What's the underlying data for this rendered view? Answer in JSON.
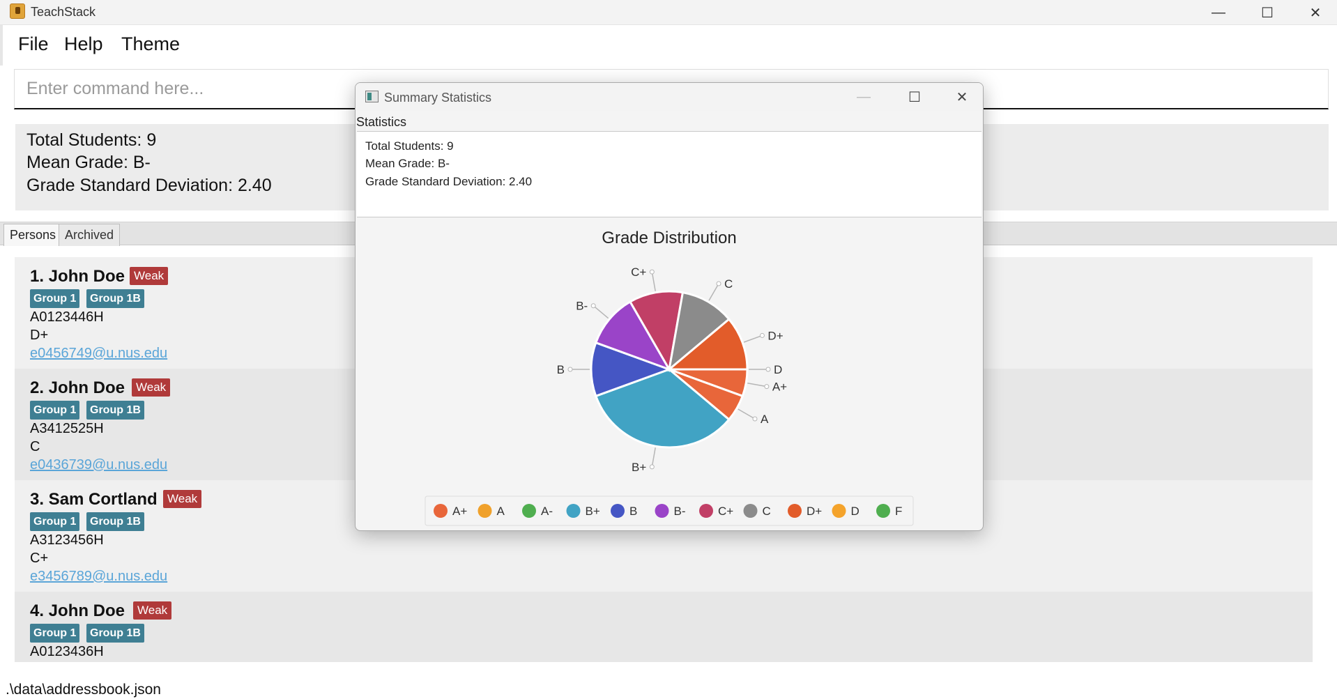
{
  "app": {
    "title": "TeachStack"
  },
  "window_controls": {
    "minimize": "—",
    "maximize": "☐",
    "close": "✕"
  },
  "menu": {
    "file": "File",
    "help": "Help",
    "theme": "Theme"
  },
  "command": {
    "placeholder": "Enter command here..."
  },
  "summary": {
    "total": "Total Students: 9",
    "mean": "Mean Grade: B-",
    "std": "Grade Standard Deviation: 2.40"
  },
  "tabs": {
    "persons": "Persons",
    "archived": "Archived"
  },
  "persons": [
    {
      "index_name": "1.  John Doe",
      "tag": "Weak",
      "groups": [
        "Group 1",
        "Group 1B"
      ],
      "id": "A0123446H",
      "grade": "D+",
      "email": "e0456749@u.nus.edu"
    },
    {
      "index_name": "2.  John Doe",
      "tag": "Weak",
      "groups": [
        "Group 1",
        "Group 1B"
      ],
      "id": "A3412525H",
      "grade": "C",
      "email": "e0436739@u.nus.edu"
    },
    {
      "index_name": "3.  Sam Cortland",
      "tag": "Weak",
      "groups": [
        "Group 1",
        "Group 1B"
      ],
      "id": "A3123456H",
      "grade": "C+",
      "email": "e3456789@u.nus.edu"
    },
    {
      "index_name": "4.  John Doe",
      "tag": "Weak",
      "groups": [
        "Group 1",
        "Group 1B"
      ],
      "id": "A0123436H",
      "grade": "",
      "email": ""
    }
  ],
  "status": {
    "path": ".\\data\\addressbook.json"
  },
  "popup": {
    "title": "Summary Statistics",
    "controls": {
      "minimize": "—",
      "maximize": "☐",
      "close": "✕"
    },
    "section_label": "Statistics",
    "stats": {
      "total": "Total Students: 9",
      "mean": "Mean Grade: B-",
      "std": "Grade Standard Deviation: 2.40"
    }
  },
  "chart_data": {
    "type": "pie",
    "title": "Grade Distribution",
    "slices": [
      {
        "label": "A+",
        "value": 0.5,
        "color": "#e8663a"
      },
      {
        "label": "A",
        "value": 0.5,
        "color": "#e8663a"
      },
      {
        "label": "B+",
        "value": 3,
        "color": "#41a3c4"
      },
      {
        "label": "B",
        "value": 1,
        "color": "#4556c4"
      },
      {
        "label": "B-",
        "value": 1,
        "color": "#9a44c8"
      },
      {
        "label": "C+",
        "value": 1,
        "color": "#c13f66"
      },
      {
        "label": "C",
        "value": 1,
        "color": "#8b8b8b"
      },
      {
        "label": "D+",
        "value": 1,
        "color": "#e25c2a"
      },
      {
        "label": "D",
        "value": 0,
        "color": "#f4a32b"
      }
    ],
    "legend": [
      {
        "label": "A+",
        "color": "#e8663a"
      },
      {
        "label": "A",
        "color": "#f0a12b"
      },
      {
        "label": "A-",
        "color": "#4fae4f"
      },
      {
        "label": "B+",
        "color": "#41a3c4"
      },
      {
        "label": "B",
        "color": "#4556c4"
      },
      {
        "label": "B-",
        "color": "#9a44c8"
      },
      {
        "label": "C+",
        "color": "#c13f66"
      },
      {
        "label": "C",
        "color": "#8b8b8b"
      },
      {
        "label": "D+",
        "color": "#e25c2a"
      },
      {
        "label": "D",
        "color": "#f4a32b"
      },
      {
        "label": "F",
        "color": "#4fae4f"
      }
    ],
    "legend_position": "bottom"
  }
}
